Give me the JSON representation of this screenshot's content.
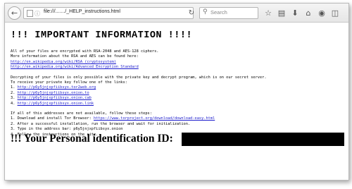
{
  "browser": {
    "url": "file:///......./_HELP_instructions.html",
    "search_placeholder": "Search",
    "reload": "↻",
    "back": "←",
    "icons": [
      "star-icon",
      "clipboard-icon",
      "download-icon",
      "home-icon",
      "chat-icon",
      "pocket-icon"
    ]
  },
  "page": {
    "heading": "!!! IMPORTANT INFORMATION !!!!",
    "para1": [
      "All of your files are encrypted with RSA-2048 and AES-128 ciphers.",
      "More information about the RSA and AES can be found here:"
    ],
    "links1": [
      "http://en.wikipedia.org/wiki/RSA_(cryptosystem)",
      "http://en.wikipedia.org/wiki/Advanced_Encryption_Standard"
    ],
    "para2": [
      "Decrypting of your files is only possible with the private key and decrypt program, which is on our secret server.",
      "To receive your private key follow one of the links:"
    ],
    "links2": [
      {
        "num": "1.",
        "url": "http://p6y5jnjxpfiibsyx.tor2web.org"
      },
      {
        "num": "2.",
        "url": "http://p6y5jnjxpfiibsyx.onion.to"
      },
      {
        "num": "3.",
        "url": "http://p6y5jnjxpfiibsyx.onion.cab"
      },
      {
        "num": "4.",
        "url": "http://p6y5jnjxpfiibsyx.onion.link"
      }
    ],
    "para3_intro": "If all of this addresses are not available, follow these steps:",
    "step1_prefix": "1. Download and install Tor Browser:",
    "step1_link": "https://www.torproject.org/download/download-easy.html",
    "step2": "2. After a successful installation, run the browser and wait for initialization.",
    "step3": "3. Type in the address bar: p6y5jnjxpfiibsyx.onion",
    "step4": "4. Follow the instructions on the site.",
    "id_label": "!!! Your Personal identification ID:"
  }
}
